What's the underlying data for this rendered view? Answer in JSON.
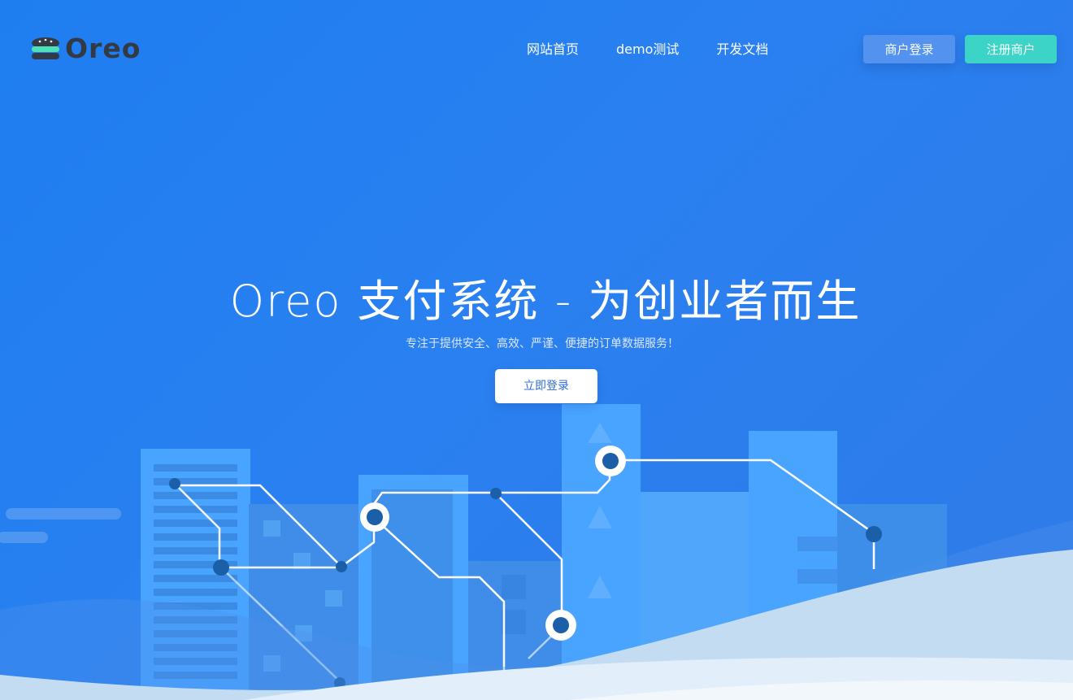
{
  "brand": {
    "name": "Oreo",
    "logo_icon": "cookie-stack-icon"
  },
  "nav": {
    "items": [
      "网站首页",
      "demo测试",
      "开发文档"
    ]
  },
  "header_actions": {
    "login_label": "商户登录",
    "register_label": "注册商户"
  },
  "hero": {
    "title": "Oreo 支付系统 - 为创业者而生",
    "subtitle": "专注于提供安全、高效、严谨、便捷的订单数据服务！",
    "cta_label": "立即登录"
  },
  "colors": {
    "background_start": "#1e7ef0",
    "background_end": "#2f7ae8",
    "login_button": "#5393ef",
    "register_button": "#3bd4c6",
    "building_light": "#48a4ff",
    "building_dark": "#3f8de8",
    "node": "#1b5fa8",
    "wave": "#d6e8f8"
  },
  "illustration": {
    "name": "city-network-illustration"
  }
}
